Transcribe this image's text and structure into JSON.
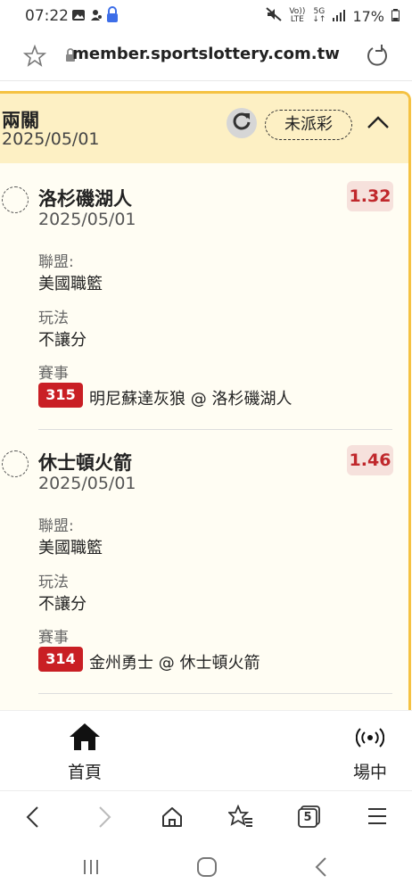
{
  "status_bar": {
    "time": "07:22",
    "volte_top": "Vo))",
    "volte_bottom": "LTE",
    "net_top": "5G",
    "net_bottom": "↓↑",
    "battery": "17%"
  },
  "browser": {
    "url": "member.sportslottery.com.tw",
    "tab_count": "5"
  },
  "card": {
    "title": "兩關",
    "date": "2025/05/01",
    "status": "未派彩"
  },
  "picks": [
    {
      "team": "洛杉磯湖人",
      "date": "2025/05/01",
      "odds": "1.32",
      "league_label": "聯盟:",
      "league": "美國職籃",
      "bet_type_label": "玩法",
      "bet_type": "不讓分",
      "event_label": "賽事",
      "game_no": "315",
      "matchup": "明尼蘇達灰狼 @ 洛杉磯湖人"
    },
    {
      "team": "休士頓火箭",
      "date": "2025/05/01",
      "odds": "1.46",
      "league_label": "聯盟:",
      "league": "美國職籃",
      "bet_type_label": "玩法",
      "bet_type": "不讓分",
      "event_label": "賽事",
      "game_no": "314",
      "matchup": "金州勇士 @ 休士頓火箭"
    }
  ],
  "app_nav": {
    "home": "首頁",
    "live": "場中"
  },
  "colors": {
    "header_bg": "#fdf0c4",
    "card_border": "#f5c242",
    "odds_text": "#c0282c",
    "game_badge": "#c91f24"
  }
}
